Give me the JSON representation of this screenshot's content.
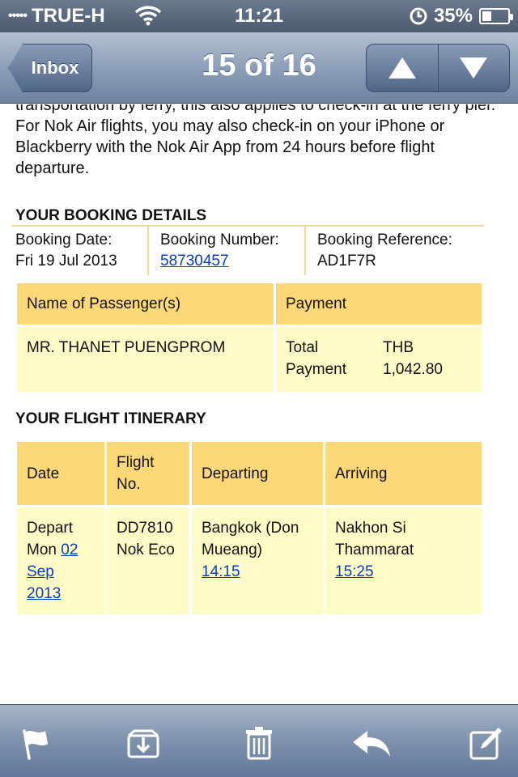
{
  "status_bar": {
    "signal_dots": "•••••",
    "carrier": "TRUE-H",
    "time": "11:21",
    "battery": "35%",
    "battery_level": 0.35
  },
  "nav": {
    "back_label": "Inbox",
    "title": "15 of 16"
  },
  "email": {
    "intro_text": "transportation by ferry, this also applies to check-in at the ferry pier. For Nok Air flights, you may also check-in on your iPhone or Blackberry with the Nok Air App from 24 hours before flight departure.",
    "booking_section_title": "YOUR BOOKING DETAILS",
    "booking": {
      "date_label": "Booking Date:",
      "date_value": "Fri 19 Jul 2013",
      "number_label": "Booking Number:",
      "number_value": "58730457",
      "reference_label": "Booking Reference:",
      "reference_value": "AD1F7R"
    },
    "passenger_table": {
      "header_name": "Name of Passenger(s)",
      "header_payment": "Payment",
      "passenger_name": "MR. THANET PUENGPROM",
      "total_label_1": "Total",
      "total_label_2": "Payment",
      "currency": "THB",
      "amount": "1,042.80"
    },
    "itinerary_section_title": "YOUR FLIGHT ITINERARY",
    "itinerary_table": {
      "headers": {
        "date": "Date",
        "flight_1": "Flight",
        "flight_2": "No.",
        "departing": "Departing",
        "arriving": "Arriving"
      },
      "row": {
        "date_prefix_1": "Depart",
        "date_prefix_2": "Mon",
        "date_link_day": "02",
        "date_link_month": "Sep",
        "date_link_year": "2013",
        "flight_no": "DD7810",
        "flight_class": "Nok Eco",
        "depart_city_1": "Bangkok (Don",
        "depart_city_2": "Mueang)",
        "depart_time": "14:15",
        "arrive_city_1": "Nakhon Si",
        "arrive_city_2": "Thammarat",
        "arrive_time": "15:25"
      }
    }
  },
  "toolbar": {
    "icons": [
      "flag-icon",
      "move-folder-icon",
      "trash-icon",
      "reply-icon",
      "compose-icon"
    ]
  },
  "colors": {
    "header_fill": "#fdd879",
    "cell_fill": "#fefbc7",
    "link": "#0a3cc2",
    "bar_blue": "#6e83a0"
  }
}
